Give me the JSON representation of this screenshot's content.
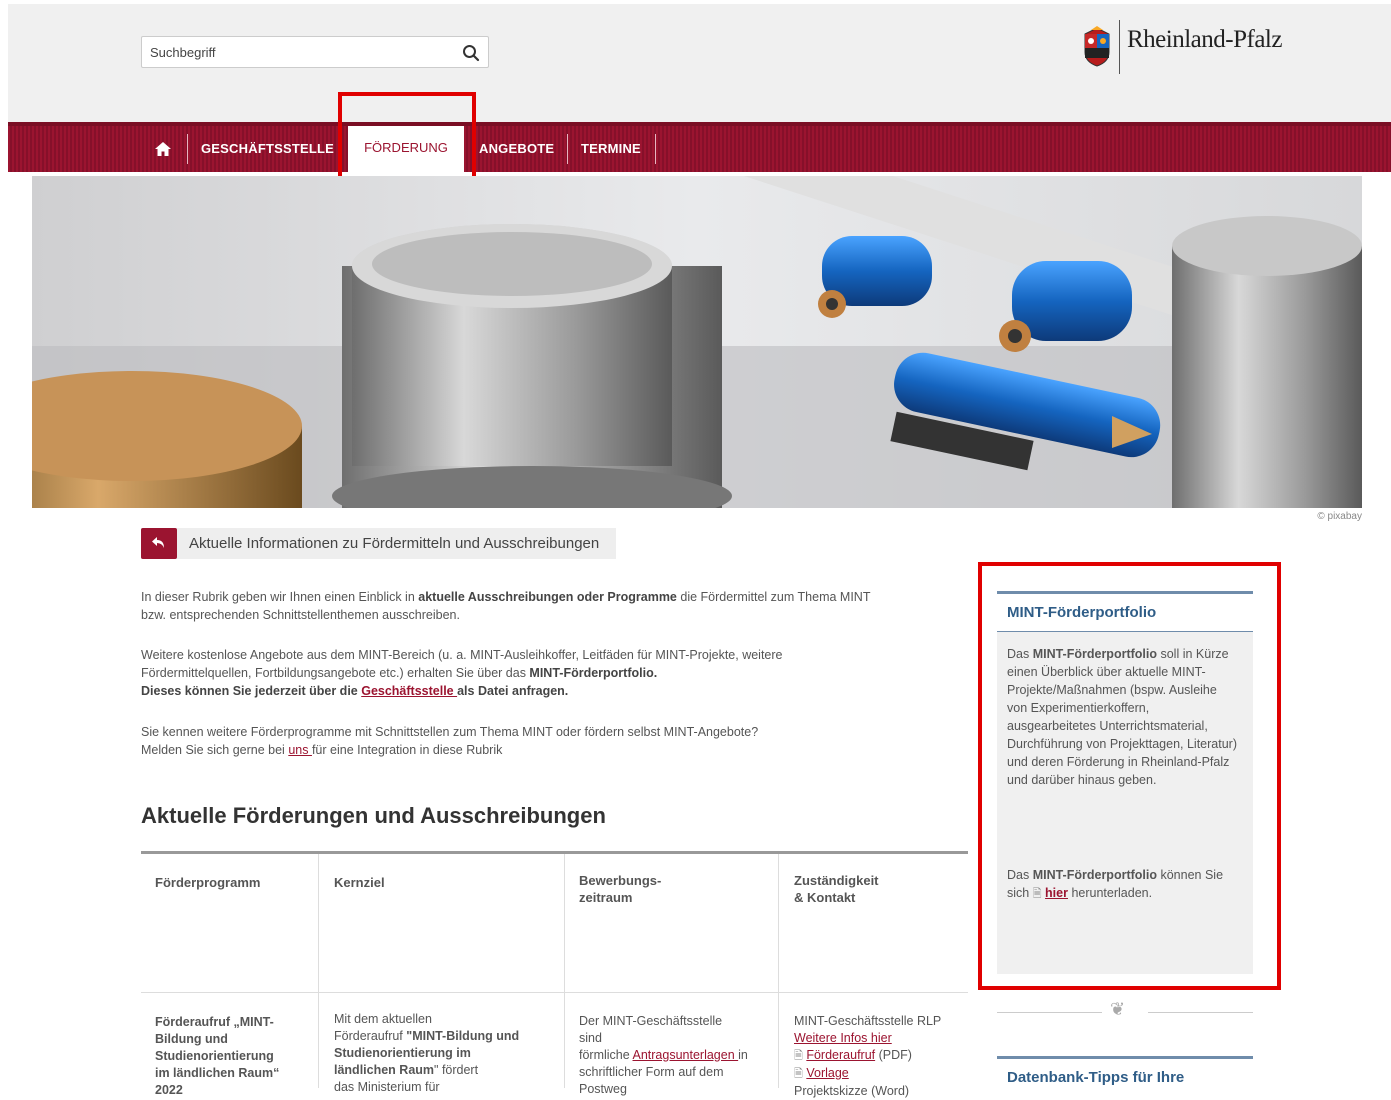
{
  "search": {
    "placeholder": "Suchbegriff"
  },
  "logo": {
    "text": "Rheinland-Pfalz"
  },
  "nav": {
    "items": [
      "GESCHÄFTSSTELLE",
      "FÖRDERUNG",
      "ANGEBOTE",
      "TERMINE"
    ],
    "active": "FÖRDERUNG"
  },
  "hero": {
    "credit": "© pixabay"
  },
  "back": {
    "label": "Aktuelle Informationen zu Fördermitteln und Ausschreibungen"
  },
  "intro": {
    "p1a": "In dieser Rubrik geben wir Ihnen einen Einblick in ",
    "p1b": "aktuelle Ausschreibungen oder Programme",
    "p1c": " die Fördermittel zum Thema MINT",
    "p1d": "bzw. entsprechenden Schnittstellenthemen ausschreiben.",
    "p2a": "Weitere kostenlose Angebote aus dem MINT-Bereich (u. a. MINT-Ausleihkoffer, Leitfäden für MINT-Projekte, weitere",
    "p2b": "Fördermittelquellen, Fortbildungsangebote etc.) erhalten Sie über das ",
    "p2c": "MINT-Förderportfolio.",
    "p2d": "Dieses können Sie jederzeit über die ",
    "p2e": "Geschäftsstelle ",
    "p2f": "als Datei anfragen.",
    "p3a": "Sie kennen weitere Förderprogramme mit Schnittstellen zum Thema MINT oder fördern selbst MINT-Angebote?",
    "p3b": "Melden Sie sich gerne bei ",
    "p3c": "uns ",
    "p3d": "für eine Integration in diese Rubrik"
  },
  "section": {
    "title": "Aktuelle Förderungen und Ausschreibungen"
  },
  "table": {
    "headers": [
      "Förderprogramm",
      "Kernziel",
      "Bewerbungs-\nzeitraum",
      "Zuständigkeit\n& Kontakt"
    ],
    "row1": {
      "c1": "Förderaufruf „MINT-\nBildung und\nStudienorientierung\nim ländlichen Raum“\n2022",
      "c2a": "Mit dem aktuellen",
      "c2b": "Förderaufruf ",
      "c2c": "\"MINT-Bildung und\nStudienorientierung im\nländlichen Raum",
      "c2d": "\" fördert",
      "c2e": "das Ministerium für",
      "c3a": "Der MINT-Geschäftsstelle",
      "c3b": "sind",
      "c3c": "förmliche ",
      "c3d": "Antragsunterlagen ",
      "c3e": "in",
      "c3f": "schriftlicher Form auf dem",
      "c3g": "Postweg",
      "c4a": "MINT-Geschäftsstelle RLP",
      "c4b": "Weitere Infos hier",
      "c4c": "Förderaufruf",
      "c4d": " (PDF)",
      "c4e": "Vorlage",
      "c4f": "Projektskizze (Word)"
    }
  },
  "sidebar": {
    "title": "MINT-Förderportfolio",
    "t1a": "Das ",
    "t1b": "MINT-Förderportfolio",
    "t1c": " soll in Kürze einen Überblick über aktuelle MINT-Projekte/Maßnahmen (bspw. Ausleihe von Experimentierkoffern, ausgearbeitetes Unterrichtsmaterial, Durchführung von Projekttagen, Literatur) und deren Förderung in Rheinland-Pfalz und darüber hinaus geben.",
    "t2a": "Das ",
    "t2b": "MINT-Förderportfolio",
    "t2c": " können Sie sich ",
    "t2d": "hier",
    "t2e": " herunterladen.",
    "title2": "Datenbank-Tipps für Ihre"
  },
  "colors": {
    "brand": "#9b1430",
    "sidebar_accent": "#2f5d87",
    "highlight": "#e00000"
  }
}
